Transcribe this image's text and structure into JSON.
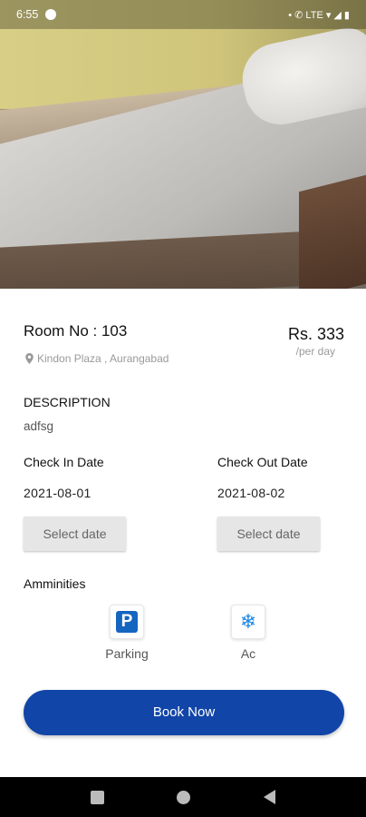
{
  "status_bar": {
    "time": "6:55",
    "indicators": "• ✆ LTE ▾ ◢ ▮"
  },
  "room": {
    "title": "Room No : 103",
    "location": "Kindon Plaza , Aurangabad",
    "price": "Rs. 333",
    "price_unit": "/per day"
  },
  "description": {
    "heading": "DESCRIPTION",
    "text": "adfsg"
  },
  "dates": {
    "check_in_label": "Check In Date",
    "check_in_value": "2021-08-01",
    "check_in_button": "Select date",
    "check_out_label": "Check Out Date",
    "check_out_value": "2021-08-02",
    "check_out_button": "Select date"
  },
  "amenities": {
    "heading": "Amminities",
    "items": [
      {
        "label": "Parking",
        "icon": "parking-icon"
      },
      {
        "label": "Ac",
        "icon": "snowflake-icon"
      }
    ]
  },
  "actions": {
    "book_label": "Book Now"
  },
  "colors": {
    "primary": "#1145a8",
    "parking_icon": "#1565c0",
    "ac_icon": "#1e88e5"
  }
}
